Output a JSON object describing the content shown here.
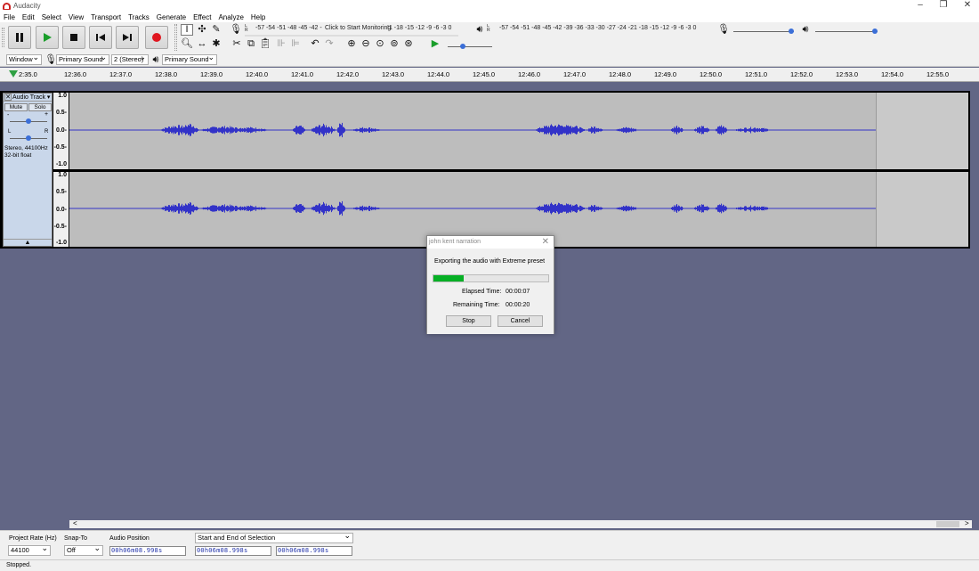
{
  "window": {
    "title": "Audacity",
    "minimize": "–",
    "restore": "❐",
    "close": "✕"
  },
  "menu": [
    "File",
    "Edit",
    "Select",
    "View",
    "Transport",
    "Tracks",
    "Generate",
    "Effect",
    "Analyze",
    "Help"
  ],
  "meters": {
    "record_scale": "-57 -54 -51 -48 -45 -42 -",
    "monitor_prompt": "Click to Start Monitoring",
    "record_scale_tail": "!1 -18 -15 -12  -9  -6  -3  0",
    "playback_scale": "-57 -54 -51 -48 -45 -42 -39 -36 -33 -30 -27 -24 -21 -18 -15 -12  -9  -6  -3  0",
    "L": "L",
    "R": "R"
  },
  "devices": {
    "host": "Window",
    "mic": "Primary Sound",
    "channels": "2 (Stereo)",
    "speaker": "Primary Sound"
  },
  "timeline": {
    "first": "2:35.0",
    "ticks": [
      "12:36.0",
      "12:37.0",
      "12:38.0",
      "12:39.0",
      "12:40.0",
      "12:41.0",
      "12:42.0",
      "12:43.0",
      "12:44.0",
      "12:45.0",
      "12:46.0",
      "12:47.0",
      "12:48.0",
      "12:49.0",
      "12:50.0",
      "12:51.0",
      "12:52.0",
      "12:53.0",
      "12:54.0",
      "12:55.0"
    ]
  },
  "track": {
    "name": "Audio Track",
    "mute": "Mute",
    "solo": "Solo",
    "gain_minus": "-",
    "gain_plus": "+",
    "pan_left": "L",
    "pan_right": "R",
    "info_line1": "Stereo, 44100Hz",
    "info_line2": "32-bit float",
    "collapse": "▲",
    "axis_labels": [
      "1.0",
      "0.5-",
      "0.0-",
      "-0.5-",
      "-1.0"
    ]
  },
  "dialog": {
    "title": "john kent narration",
    "close": "✕",
    "message": "Exporting the audio with Extreme preset",
    "progress": 0.26,
    "elapsed_label": "Elapsed Time:",
    "elapsed_value": "00:00:07",
    "remaining_label": "Remaining Time:",
    "remaining_value": "00:00:20",
    "stop": "Stop",
    "cancel": "Cancel"
  },
  "scroll": {
    "left": "<",
    "right": ">"
  },
  "selection": {
    "rate_label": "Project Rate (Hz)",
    "rate_value": "44100",
    "snap_label": "Snap-To",
    "snap_value": "Off",
    "position_label": "Audio Position",
    "range_label": "Start and End of Selection",
    "position_value": "00h06m08.998s",
    "start_value": "00h06m08.998s",
    "end_value": "00h06m08.998s"
  },
  "status": "Stopped.",
  "colors": {
    "waveform": "#3232c8",
    "workspace": "#626685",
    "progress": "#06b025",
    "record": "#e0161f",
    "play": "#1a9e2a"
  }
}
